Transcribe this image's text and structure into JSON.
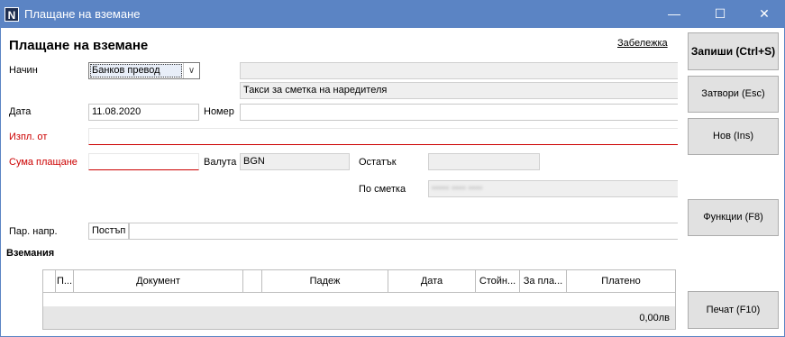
{
  "window": {
    "app_icon": "N",
    "title": "Плащане на вземане",
    "minimize": "—",
    "maximize": "☐",
    "close": "✕"
  },
  "form": {
    "heading": "Плащане на вземане",
    "notes_link": "Забележка",
    "method": {
      "label": "Начин",
      "value": "Банков превод",
      "extra": "",
      "fee_note": "Такси за сметка на наредителя"
    },
    "date": {
      "label": "Дата",
      "value": "11.08.2020"
    },
    "number": {
      "label": "Номер",
      "value": ""
    },
    "payer": {
      "label": "Изпл. от",
      "value": ""
    },
    "amount": {
      "label": "Сума плащане",
      "value": ""
    },
    "currency": {
      "label": "Валута",
      "value": "BGN"
    },
    "remaining": {
      "label": "Остатък",
      "value": ""
    },
    "account": {
      "label": "По сметка",
      "value": "••••• •••• ••••"
    },
    "cash_flow": {
      "label": "Пар. напр.",
      "value": "Постъп",
      "value2": ""
    }
  },
  "receivables": {
    "heading": "Вземания",
    "columns": [
      "П...",
      "Документ",
      "",
      "Падеж",
      "Дата",
      "Стойн...",
      "За пла...",
      "Платено"
    ],
    "rows": [],
    "total": "0,00лв"
  },
  "buttons": {
    "save": "Запиши (Ctrl+S)",
    "close": "Затвори (Esc)",
    "new": "Нов (Ins)",
    "functions": "Функции (F8)",
    "print": "Печат (F10)"
  },
  "colors": {
    "titlebar": "#5b84c4",
    "required_label": "#cc0000"
  },
  "icons": {
    "dropdown": "chevron-down-icon",
    "window_minimize": "minimize-icon",
    "window_maximize": "maximize-icon",
    "window_close": "close-icon"
  }
}
